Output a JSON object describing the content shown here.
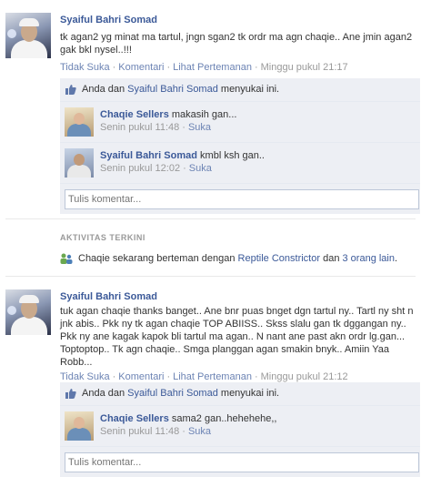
{
  "posts": [
    {
      "author": "Syaiful Bahri Somad",
      "message": "tk agan2 yg minat ma tartul, jngn sgan2 tk ordr ma agn chaqie.. Ane jmin agan2 gak bkl nysel..!!!",
      "actions": {
        "unlike": "Tidak Suka",
        "comment": "Komentari",
        "friendship": "Lihat Pertemanan",
        "time": "Minggu pukul 21:17"
      },
      "likes": {
        "prefix": "Anda dan",
        "name": "Syaiful Bahri Somad",
        "suffix": "menyukai ini."
      },
      "comments": [
        {
          "author": "Chaqie Sellers",
          "text": "makasih gan...",
          "time": "Senin pukul 11:48",
          "like": "Suka"
        },
        {
          "author": "Syaiful Bahri Somad",
          "text": "kmbl ksh gan..",
          "time": "Senin pukul 12:02",
          "like": "Suka"
        }
      ],
      "comment_placeholder": "Tulis komentar..."
    },
    {
      "author": "Syaiful Bahri Somad",
      "message": "tuk agan chaqie thanks banget.. Ane bnr puas bnget dgn tartul ny.. Tartl ny sht n jnk abis.. Pkk ny tk agan chaqie TOP ABIISS.. Skss slalu gan tk dggangan ny.. Pkk ny ane kagak kapok bli tartul ma agan.. N nant ane past akn ordr lg.gan... Toptoptop.. Tk agn chaqie.. Smga planggan agan smakin bnyk.. Amiin Yaa Robb...",
      "actions": {
        "unlike": "Tidak Suka",
        "comment": "Komentari",
        "friendship": "Lihat Pertemanan",
        "time": "Minggu pukul 21:12"
      },
      "likes": {
        "prefix": "Anda dan",
        "name": "Syaiful Bahri Somad",
        "suffix": "menyukai ini."
      },
      "comments": [
        {
          "author": "Chaqie Sellers",
          "text": "sama2 gan..hehehehe,,",
          "time": "Senin pukul 11:48",
          "like": "Suka"
        }
      ],
      "comment_placeholder": "Tulis komentar..."
    }
  ],
  "activity": {
    "heading": "AKTIVITAS TERKINI",
    "text1": "Chaqie sekarang berteman dengan",
    "link1": "Reptile Constrictor",
    "text2": "dan",
    "link2": "3 orang lain",
    "end": "."
  },
  "icons": {
    "like": "thumbs-up-icon",
    "friend": "friends-icon"
  },
  "colors": {
    "link": "#3b5998",
    "ufi_bg": "#edeff4",
    "meta": "#999999"
  }
}
